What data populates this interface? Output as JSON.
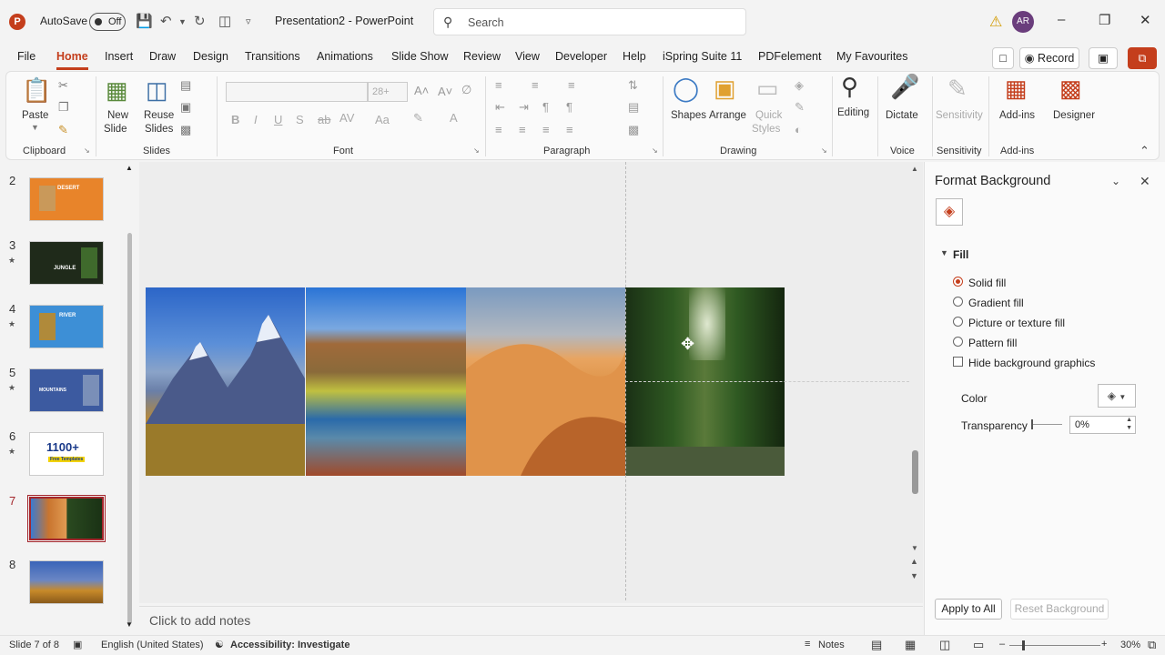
{
  "titlebar": {
    "logo": "P",
    "autosave": "AutoSave",
    "toggle": "Off",
    "title": "Presentation2  -  PowerPoint",
    "search_placeholder": "Search",
    "avatar": "AR",
    "icons": [
      "save-icon",
      "undo-icon",
      "redo-icon",
      "present-icon",
      "customize-icon",
      "warning-icon",
      "minimize-icon",
      "restore-icon",
      "close-icon"
    ]
  },
  "tabs": [
    "File",
    "Home",
    "Insert",
    "Draw",
    "Design",
    "Transitions",
    "Animations",
    "Slide Show",
    "Review",
    "View",
    "Developer",
    "Help",
    "iSpring Suite 11",
    "PDFelement",
    "My Favourites"
  ],
  "active_tab": "Home",
  "record_label": "Record",
  "ribbon": {
    "paste": "Paste",
    "clipboard": "Clipboard",
    "new_slide": "New",
    "new_slide2": "Slide",
    "reuse": "Reuse",
    "reuse2": "Slides",
    "slides": "Slides",
    "font_size": "28+",
    "font": "Font",
    "paragraph": "Paragraph",
    "shapes": "Shapes",
    "arrange": "Arrange",
    "quick_styles": "Quick",
    "quick_styles2": "Styles",
    "drawing": "Drawing",
    "editing": "Editing",
    "dictate": "Dictate",
    "voice": "Voice",
    "sensitivity": "Sensitivity",
    "sensitivity_grp": "Sensitivity",
    "addins": "Add-ins",
    "addins_grp": "Add-ins",
    "designer": "Designer"
  },
  "slides": [
    {
      "num": "2",
      "star": false,
      "title": "DESERT",
      "bg": "#e8842a"
    },
    {
      "num": "3",
      "star": true,
      "title": "JUNGLE",
      "bg": "#1f2a1a"
    },
    {
      "num": "4",
      "star": true,
      "title": "RIVER",
      "bg": "#3d8fd6"
    },
    {
      "num": "5",
      "star": true,
      "title": "MOUNTAINS",
      "bg": "#3c5aa0"
    },
    {
      "num": "6",
      "star": true,
      "title": "1100+",
      "subtitle": "Free Templates",
      "bg": "#ffffff"
    },
    {
      "num": "7",
      "star": false,
      "title": "",
      "bg": "#d88a3a",
      "selected": true
    },
    {
      "num": "8",
      "star": false,
      "title": "",
      "bg": "#4a6fb0"
    }
  ],
  "notes_placeholder": "Click to add notes",
  "pane": {
    "title": "Format Background",
    "section": "Fill",
    "options": [
      {
        "label": "Solid fill",
        "checked": true
      },
      {
        "label": "Gradient fill",
        "checked": false
      },
      {
        "label": "Picture or texture fill",
        "checked": false
      },
      {
        "label": "Pattern fill",
        "checked": false
      }
    ],
    "hide_graphics": "Hide background graphics",
    "color_label": "Color",
    "transparency_label": "Transparency",
    "transparency_value": "0%",
    "apply_all": "Apply to All",
    "reset": "Reset Background"
  },
  "status": {
    "slide": "Slide 7 of 8",
    "language": "English (United States)",
    "accessibility": "Accessibility: Investigate",
    "notes": "Notes",
    "zoom": "30%"
  },
  "colors": {
    "accent": "#c43e1c",
    "selected_thumb": "#a4262c"
  }
}
